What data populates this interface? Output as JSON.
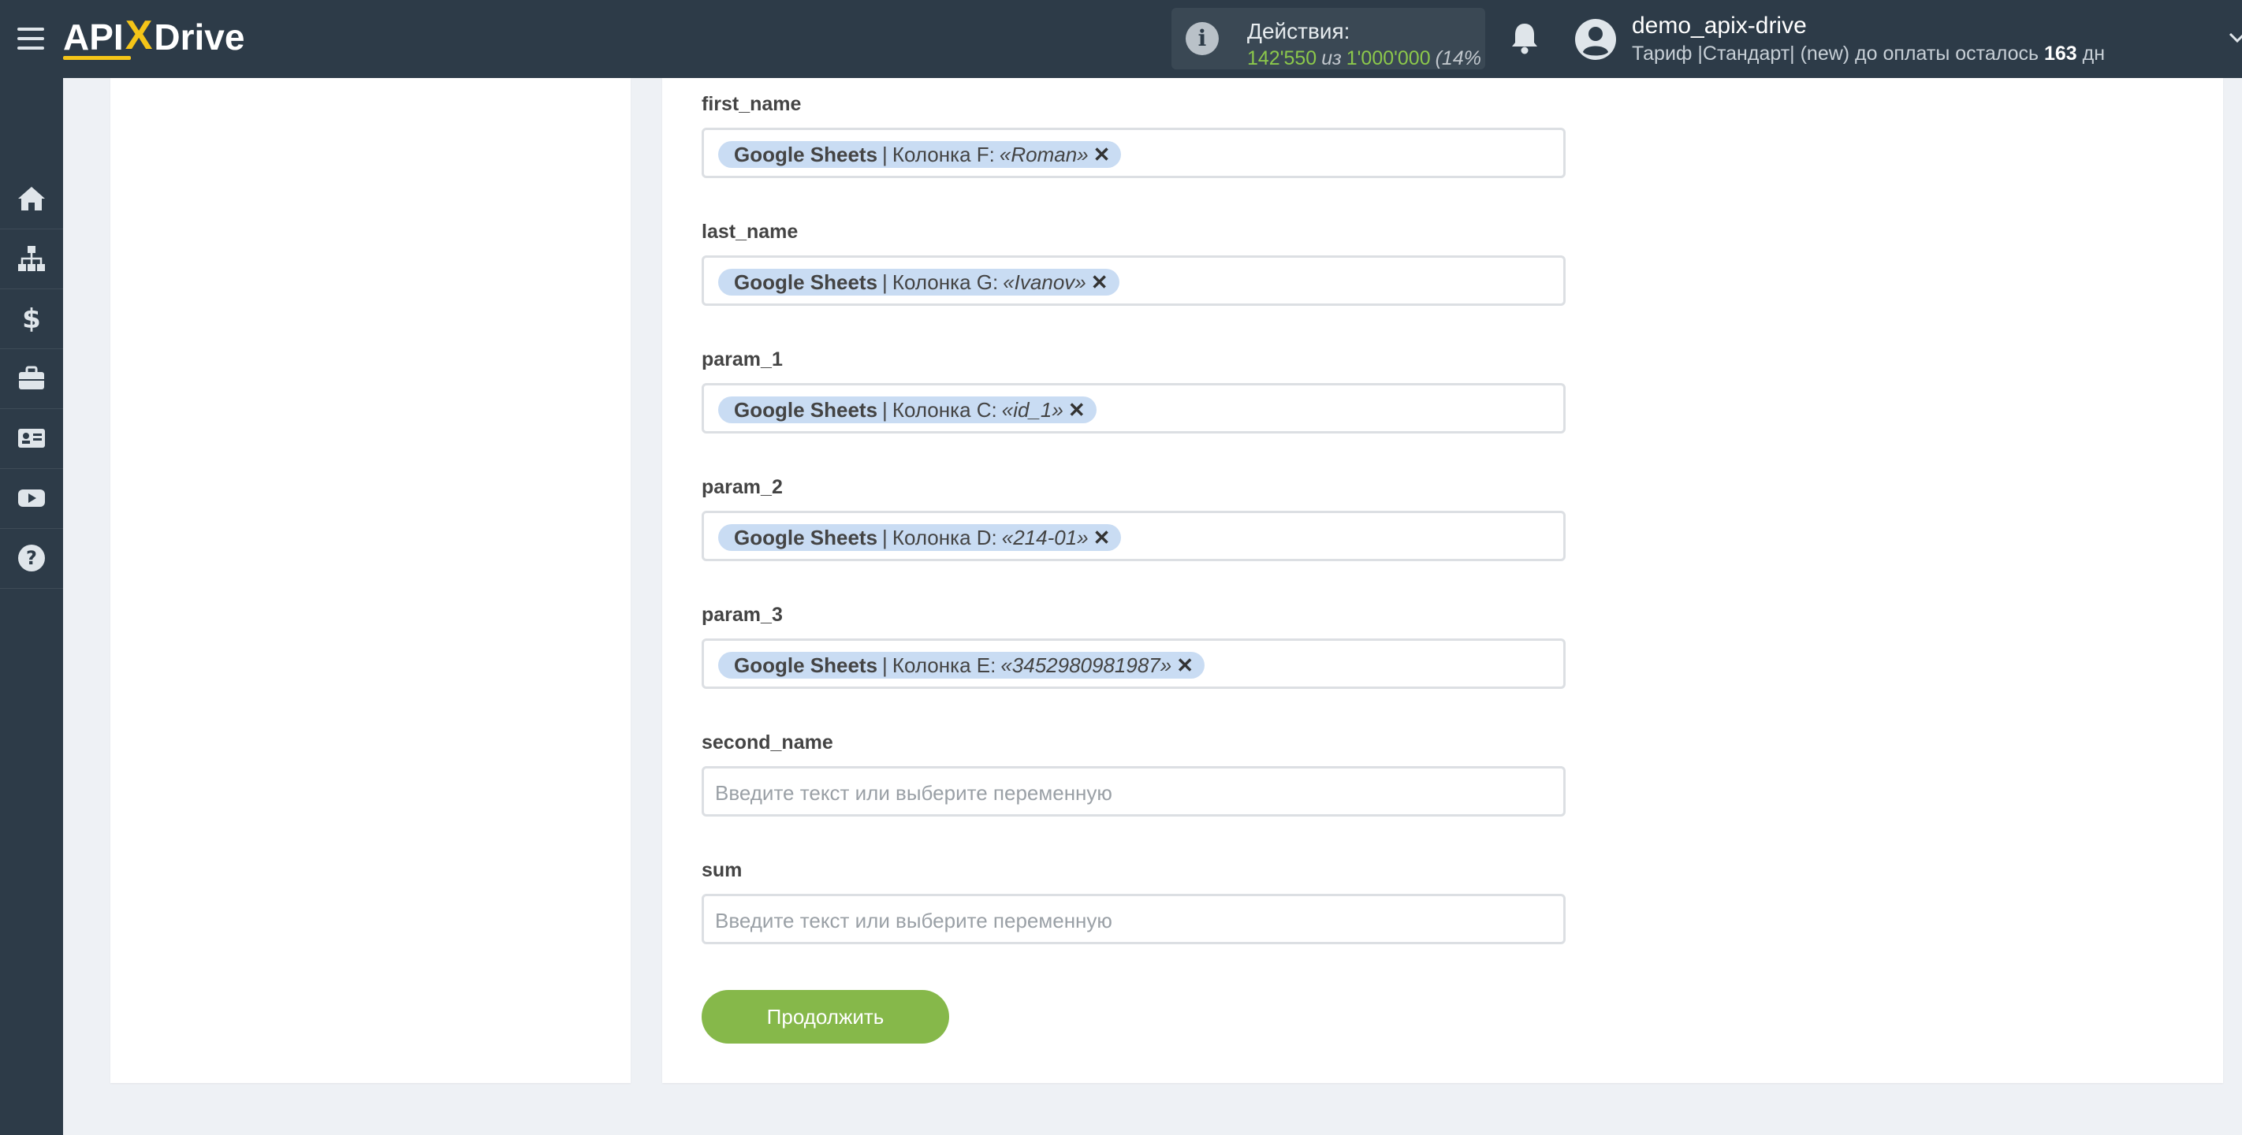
{
  "header": {
    "logo": {
      "api": "API",
      "x": "X",
      "drive": "Drive"
    },
    "actions_label": "Действия:",
    "actions_used": "142'550",
    "actions_of": "из",
    "actions_total": "1'000'000",
    "actions_pct": "(14%",
    "username": "demo_apix-drive",
    "tariff_prefix": "Тариф |Стандарт| (new) до оплаты осталось",
    "tariff_days": "163",
    "tariff_suffix": "дн"
  },
  "sidebar": {
    "items": [
      {
        "icon": "home-icon"
      },
      {
        "icon": "sitemap-icon"
      },
      {
        "icon": "dollar-icon"
      },
      {
        "icon": "briefcase-icon"
      },
      {
        "icon": "id-card-icon"
      },
      {
        "icon": "youtube-icon"
      },
      {
        "icon": "help-icon"
      }
    ]
  },
  "fields": [
    {
      "label": "first_name",
      "tag": {
        "source": "Google Sheets",
        "sep": "|",
        "column": "Колонка F:",
        "value": "«Roman»",
        "remove": "✕"
      }
    },
    {
      "label": "last_name",
      "tag": {
        "source": "Google Sheets",
        "sep": "|",
        "column": "Колонка G:",
        "value": "«Ivanov»",
        "remove": "✕"
      }
    },
    {
      "label": "param_1",
      "tag": {
        "source": "Google Sheets",
        "sep": "|",
        "column": "Колонка C:",
        "value": "«id_1»",
        "remove": "✕"
      }
    },
    {
      "label": "param_2",
      "tag": {
        "source": "Google Sheets",
        "sep": "|",
        "column": "Колонка D:",
        "value": "«214-01»",
        "remove": "✕"
      }
    },
    {
      "label": "param_3",
      "tag": {
        "source": "Google Sheets",
        "sep": "|",
        "column": "Колонка E:",
        "value": "«3452980981987»",
        "remove": "✕"
      }
    },
    {
      "label": "second_name",
      "placeholder": "Введите текст или выберите переменную"
    },
    {
      "label": "sum",
      "placeholder": "Введите текст или выберите переменную"
    }
  ],
  "continue_label": "Продолжить",
  "colors": {
    "topbar": "#2d3b48",
    "accent_green": "#86b84a",
    "tag_bg": "#c9dcf3",
    "logo_yellow": "#f5c518"
  }
}
